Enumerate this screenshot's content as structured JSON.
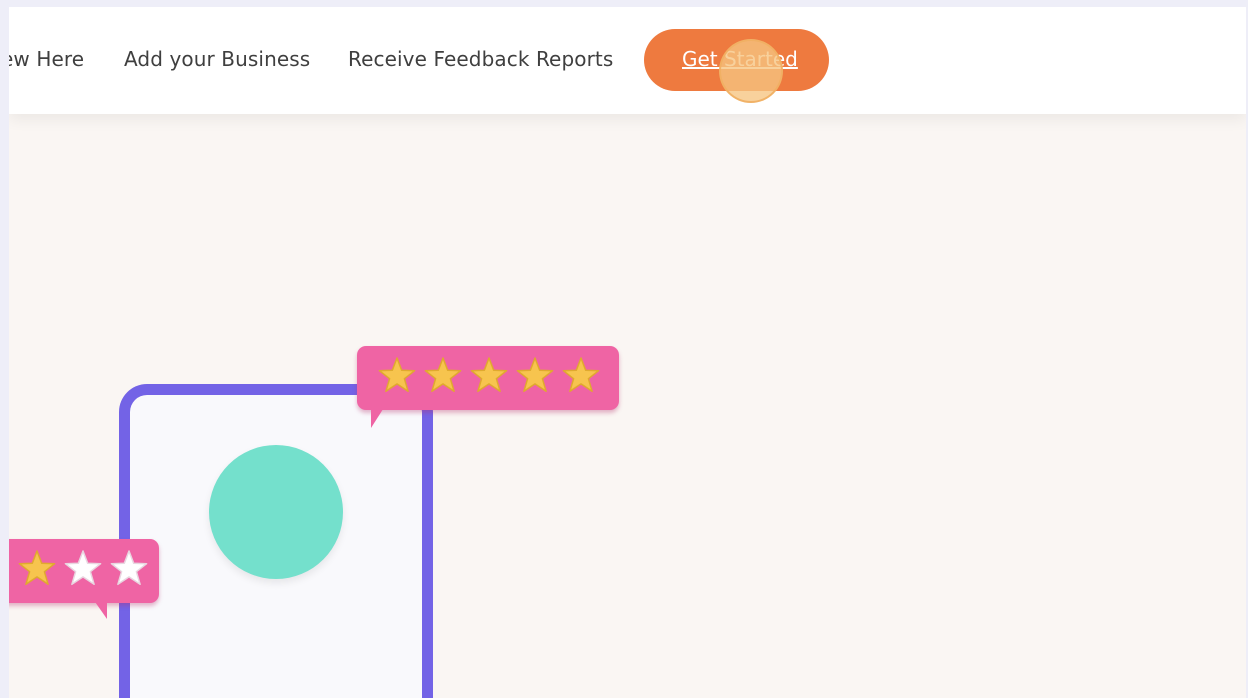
{
  "nav": {
    "links": [
      "ew Here",
      "Add your Business",
      "Receive Feedback Reports"
    ],
    "cta_label": "Get Started"
  },
  "hero": {
    "review_bubbles": [
      {
        "rating": 5,
        "max": 5,
        "filled_color": "#f7c44e"
      },
      {
        "rating": 1,
        "max": 3,
        "filled_color": "#f7c44e",
        "empty_color": "#ffffff"
      }
    ]
  },
  "colors": {
    "accent": "#ee7a3f",
    "bubble": "#ef64a4",
    "phone_frame": "#7363e6",
    "avatar": "#74e0cc",
    "background": "#faf6f3"
  }
}
